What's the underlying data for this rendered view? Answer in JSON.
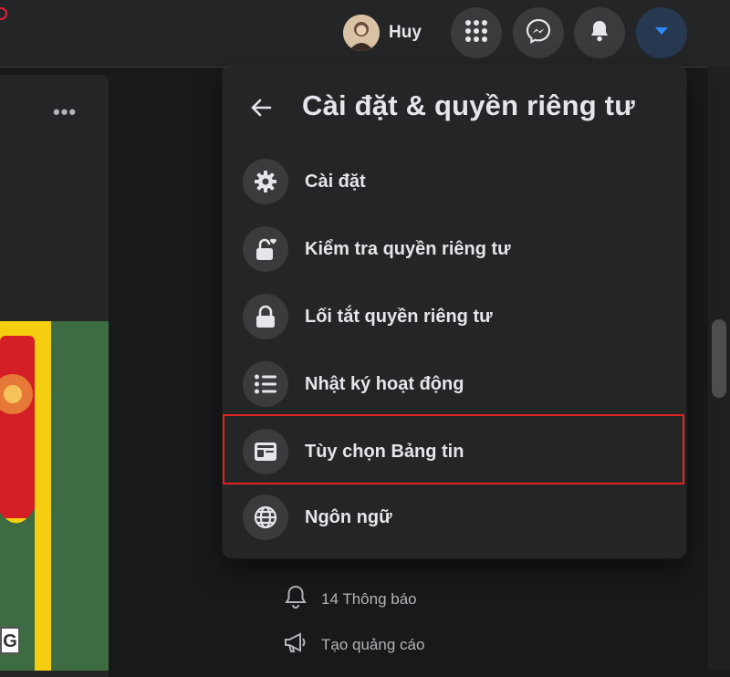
{
  "header": {
    "user_name": "Huy",
    "icons": [
      "menu-grid-icon",
      "messenger-icon",
      "bell-icon",
      "caret-down-icon"
    ]
  },
  "post": {
    "more_label": "•••",
    "badge_letter": "G"
  },
  "panel": {
    "title": "Cài đặt & quyền riêng tư",
    "items": [
      {
        "label": "Cài đặt",
        "icon": "gear-icon"
      },
      {
        "label": "Kiểm tra quyền riêng tư",
        "icon": "lock-heart-icon"
      },
      {
        "label": "Lối tắt quyền riêng tư",
        "icon": "lock-icon"
      },
      {
        "label": "Nhật ký hoạt động",
        "icon": "list-icon"
      },
      {
        "label": "Tùy chọn Bảng tin",
        "icon": "news-feed-icon",
        "highlighted": true
      },
      {
        "label": "Ngôn ngữ",
        "icon": "globe-icon"
      }
    ]
  },
  "sidebar": {
    "items": [
      {
        "label": "14 Thông báo",
        "icon": "bell-outline-icon"
      },
      {
        "label": "Tạo quảng cáo",
        "icon": "megaphone-icon"
      }
    ]
  },
  "colors": {
    "background": "#18191a",
    "surface": "#242526",
    "icon_bg": "#3a3b3c",
    "accent_blue": "#2d88ff",
    "highlight_red": "#e02424"
  }
}
